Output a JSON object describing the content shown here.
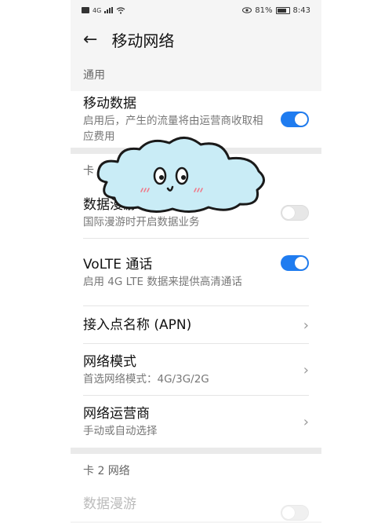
{
  "status": {
    "left_icons": [
      "sim-card-icon",
      "signal-icon",
      "wifi-icon"
    ],
    "signal_label": "4G",
    "battery": "81%",
    "time": "8:43"
  },
  "header": {
    "title": "移动网络"
  },
  "sections": {
    "general": "通用",
    "card1": "卡 1 网络",
    "card2": "卡 2 网络"
  },
  "rows": {
    "mobile_data": {
      "title": "移动数据",
      "subtitle": "启用后，产生的流量将由运营商收取相应费用",
      "toggle": "on"
    },
    "roaming1": {
      "title": "数据漫游",
      "subtitle": "国际漫游时开启数据业务",
      "toggle": "off"
    },
    "volte": {
      "title": "VoLTE 通话",
      "subtitle": "启用 4G LTE 数据来提供高清通话",
      "toggle": "on"
    },
    "apn": {
      "title": "接入点名称 (APN)"
    },
    "network_mode": {
      "title": "网络模式",
      "subtitle": "首选网络模式：4G/3G/2G"
    },
    "operator": {
      "title": "网络运营商",
      "subtitle": "手动或自动选择"
    },
    "roaming2": {
      "title": "数据漫游"
    }
  },
  "colors": {
    "accent": "#1f7cf0",
    "background": "#f5f5f5",
    "cloud_fill": "#c9ecf6"
  }
}
